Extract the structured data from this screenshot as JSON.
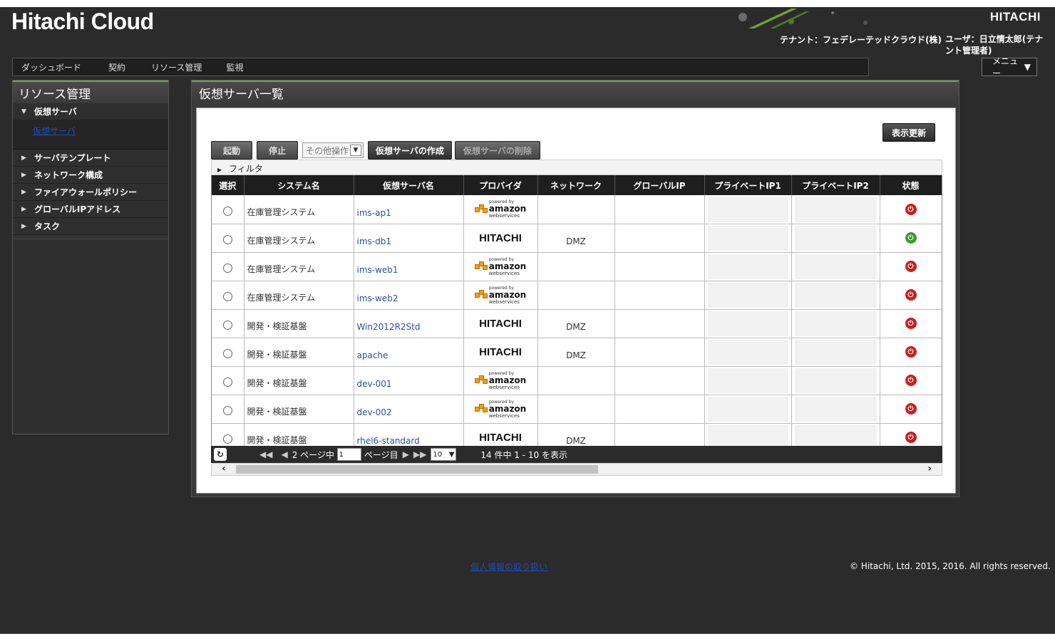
{
  "header": {
    "brand": "Hitachi Cloud",
    "logo_right": "HITACHI",
    "tenant": "テナント：フェデレーテッドクラウド(株)",
    "user": "ユーザ：日立情太郎(テナント管理者)"
  },
  "topnav": {
    "items": [
      "ダッシュボード",
      "契約",
      "リソース管理",
      "監視"
    ],
    "menu_label": "メニュー"
  },
  "sidebar": {
    "title": "リソース管理",
    "expanded_item": "仮想サーバ",
    "sub_link": "仮想サーバ",
    "items": [
      "サーバテンプレート",
      "ネットワーク構成",
      "ファイアウォールポリシー",
      "グローバルIPアドレス",
      "タスク"
    ]
  },
  "main": {
    "title": "仮想サーバ一覧",
    "refresh_label": "表示更新",
    "toolbar": {
      "start": "起動",
      "stop": "停止",
      "other_ops": "その他操作",
      "create": "仮想サーバの作成",
      "delete": "仮想サーバの削除"
    },
    "filter_label": "フィルタ",
    "columns": [
      "選択",
      "システム名",
      "仮想サーバ名",
      "プロバイダ",
      "ネットワーク",
      "グローバルIP",
      "プライベートIP1",
      "プライベートIP2",
      "状態"
    ],
    "rows": [
      {
        "system": "在庫管理システム",
        "server": "ims-ap1",
        "provider": "aws",
        "network": "",
        "status": "stopped"
      },
      {
        "system": "在庫管理システム",
        "server": "ims-db1",
        "provider": "hitachi",
        "network": "DMZ",
        "status": "running"
      },
      {
        "system": "在庫管理システム",
        "server": "ims-web1",
        "provider": "aws",
        "network": "",
        "status": "stopped"
      },
      {
        "system": "在庫管理システム",
        "server": "ims-web2",
        "provider": "aws",
        "network": "",
        "status": "stopped"
      },
      {
        "system": "開発・検証基盤",
        "server": "Win2012R2Std",
        "provider": "hitachi",
        "network": "DMZ",
        "status": "stopped"
      },
      {
        "system": "開発・検証基盤",
        "server": "apache",
        "provider": "hitachi",
        "network": "DMZ",
        "status": "stopped"
      },
      {
        "system": "開発・検証基盤",
        "server": "dev-001",
        "provider": "aws",
        "network": "",
        "status": "stopped"
      },
      {
        "system": "開発・検証基盤",
        "server": "dev-002",
        "provider": "aws",
        "network": "",
        "status": "stopped"
      },
      {
        "system": "開発・検証基盤",
        "server": "rhel6-standard",
        "provider": "hitachi",
        "network": "DMZ",
        "status": "stopped"
      }
    ],
    "provider_labels": {
      "hitachi": "HITACHI",
      "aws_powered": "powered by",
      "aws_name": "amazon",
      "aws_sub": "webservices"
    },
    "pager": {
      "page_prefix": "2 ページ中",
      "page_value": "1",
      "page_suffix": "ページ目",
      "page_size": "10",
      "summary": "14 件中 1 - 10 を表示"
    }
  },
  "footer": {
    "privacy_link": "個人情報の取り扱い",
    "copyright": "© Hitachi, Ltd. 2015, 2016. All rights reserved."
  },
  "colors": {
    "accent_green": "#6aa84f",
    "status_stop": "#cc1e1e",
    "status_run": "#3a9b2a",
    "background": "#2b2b2b"
  },
  "icons": {
    "sort_menu": "chevron-down-icon",
    "status_stopped": "power-stop-icon",
    "status_running": "power-on-icon",
    "reload": "reload-icon"
  }
}
